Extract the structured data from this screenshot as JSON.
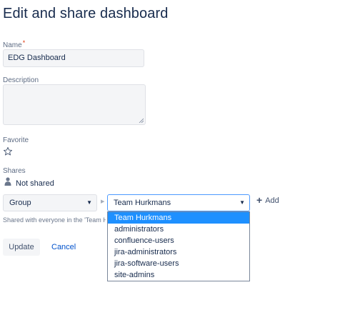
{
  "page": {
    "title": "Edit and share dashboard"
  },
  "form": {
    "name_label": "Name",
    "required_mark": "*",
    "name_value": "EDG Dashboard",
    "description_label": "Description",
    "description_value": "",
    "favorite_label": "Favorite",
    "shares_label": "Shares",
    "shares_status": "Not shared"
  },
  "share": {
    "type_select": "Group",
    "group_select": "Team Hurkmans",
    "add_label": "Add",
    "note": "Shared with everyone in the 'Team Hurkmans' group",
    "options": [
      {
        "label": "Team Hurkmans",
        "selected": true
      },
      {
        "label": "administrators",
        "selected": false
      },
      {
        "label": "confluence-users",
        "selected": false
      },
      {
        "label": "jira-administrators",
        "selected": false
      },
      {
        "label": "jira-software-users",
        "selected": false
      },
      {
        "label": "site-admins",
        "selected": false
      }
    ]
  },
  "actions": {
    "update_label": "Update",
    "cancel_label": "Cancel"
  },
  "icons": {
    "favorite": "star-outline-icon",
    "share_status": "user-icon",
    "select_caret": "caret-down-icon",
    "separator": "caret-right-icon",
    "add": "plus-icon"
  },
  "colors": {
    "text": "#172b4d",
    "label": "#5e6c84",
    "link": "#0052cc",
    "selected_option": "#1e90ff",
    "focus_border": "#4c9aff",
    "required": "#de350b"
  }
}
